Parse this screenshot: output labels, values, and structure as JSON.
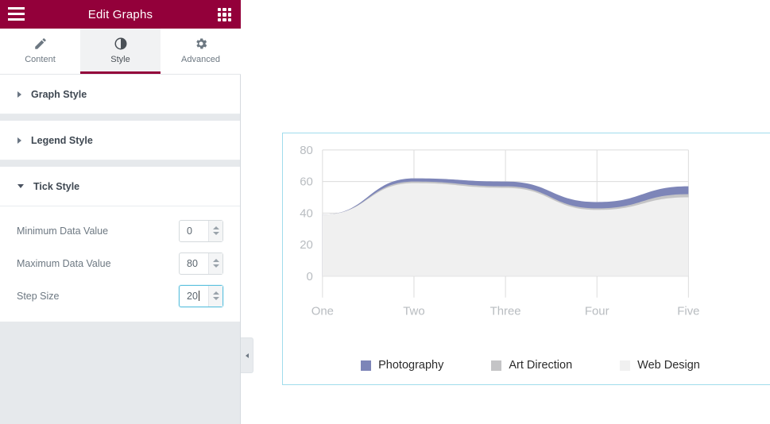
{
  "panel": {
    "title": "Edit Graphs",
    "menu_icon": "hamburger-icon",
    "apps_icon": "apps-grid-icon",
    "tabs": [
      {
        "label": "Content",
        "icon": "pencil-icon",
        "active": false
      },
      {
        "label": "Style",
        "icon": "contrast-icon",
        "active": true
      },
      {
        "label": "Advanced",
        "icon": "gear-icon",
        "active": false
      }
    ],
    "sections": [
      {
        "label": "Graph Style",
        "expanded": false
      },
      {
        "label": "Legend Style",
        "expanded": false
      },
      {
        "label": "Tick Style",
        "expanded": true
      }
    ],
    "fields": [
      {
        "label": "Minimum Data Value",
        "value": "0",
        "focused": false
      },
      {
        "label": "Maximum Data Value",
        "value": "80",
        "focused": false
      },
      {
        "label": "Step Size",
        "value": "20",
        "focused": true
      }
    ],
    "collapse_handle_icon": "chevron-left-icon"
  },
  "colors": {
    "header": "#93003a",
    "active_tab_underline": "#93003a",
    "selection_border": "#a0dcec",
    "photography": "#7d85b8",
    "art_direction": "#c4c4c6",
    "web_design": "#f0f0f0",
    "grid": "#dcdcdc",
    "axis_text": "#b8bcc0",
    "focus_border": "#5bc0de"
  },
  "chart_data": {
    "type": "area",
    "title": "",
    "xlabel": "",
    "ylabel": "",
    "categories": [
      "One",
      "Two",
      "Three",
      "Four",
      "Five"
    ],
    "x_tick_labels": [
      "One",
      "Two",
      "Three",
      "Four",
      "Five"
    ],
    "y_tick_labels": [
      "80",
      "60",
      "40",
      "20",
      "0"
    ],
    "y_ticks": [
      0,
      20,
      40,
      60,
      80
    ],
    "ylim": [
      0,
      80
    ],
    "step_size": 20,
    "grid": true,
    "legend_position": "bottom",
    "series": [
      {
        "name": "Photography",
        "color": "#7d85b8",
        "values": [
          39,
          62,
          60,
          47,
          57
        ]
      },
      {
        "name": "Art Direction",
        "color": "#c4c4c6",
        "values": [
          39,
          60,
          57,
          43,
          52
        ]
      },
      {
        "name": "Web Design",
        "color": "#f0f0f0",
        "values": [
          39,
          59,
          56,
          42,
          50
        ]
      }
    ]
  }
}
